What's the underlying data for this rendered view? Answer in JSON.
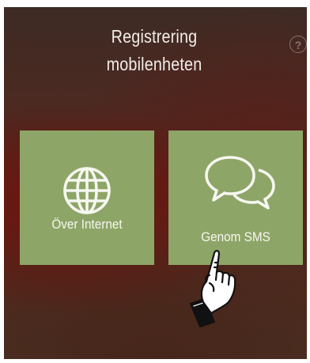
{
  "header": {
    "title_line1": "Registrering",
    "title_line2": "mobilenheten",
    "help_label": "?"
  },
  "options": [
    {
      "label": "Över Internet",
      "icon": "globe-icon"
    },
    {
      "label": "Genom SMS",
      "icon": "chat-bubbles-icon"
    }
  ],
  "pointer": {
    "icon": "pointing-hand-icon"
  },
  "colors": {
    "tile": "#8ea568",
    "tile_text": "#f6f7f0",
    "background_dark": "#3d2b24",
    "background_red": "#6e120c"
  }
}
